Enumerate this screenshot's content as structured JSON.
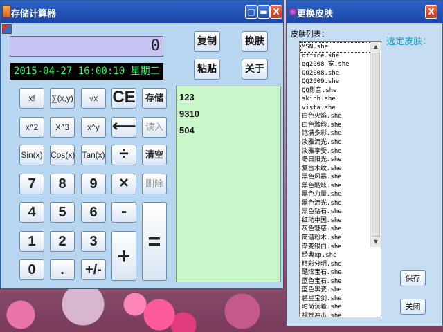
{
  "calculator": {
    "title": "存储计算器",
    "display_value": "0",
    "datetime": "2015-04-27 16:00:10 星期二",
    "window_buttons": {
      "close": "X"
    },
    "top_buttons": {
      "copy": "复制",
      "skin": "换肤",
      "paste": "粘贴",
      "about": "关于"
    },
    "keys": {
      "row1": [
        "x!",
        "∑(x,y)",
        "√x",
        "CE",
        "存储"
      ],
      "row2": [
        "x^2",
        "X^3",
        "x^y",
        "⟵",
        "读入"
      ],
      "row3": [
        "Sin(x)",
        "Cos(x)",
        "Tan(x)",
        "÷",
        "清空"
      ],
      "row4": [
        "7",
        "8",
        "9",
        "×",
        "删除"
      ],
      "row5": [
        "4",
        "5",
        "6",
        "-"
      ],
      "row6": [
        "1",
        "2",
        "3"
      ],
      "row7": [
        "0",
        ".",
        "+/-"
      ],
      "plus": "+",
      "equals": "="
    },
    "history": [
      "123",
      "9310",
      "504"
    ]
  },
  "skin_window": {
    "title": "更换皮肤",
    "close": "X",
    "list_label": "皮肤列表：",
    "select_label": "选定皮肤：",
    "items": [
      "MSN.she",
      "office.she",
      "qq2008 宽.she",
      "QQ2008.she",
      "QQ2009.she",
      "QQ影音.she",
      "skinh.she",
      "vista.she",
      "白色火焰.she",
      "白色雅韵.she",
      "饱满多彩.she",
      "淡雅流光.she",
      "淡雅享受.she",
      "冬日阳光.she",
      "复古木纹.she",
      "黑色风暴.she",
      "黑色酷炫.she",
      "黑色力量.she",
      "黑色流光.she",
      "黑色钻石.she",
      "红动中国.she",
      "灰色魅惑.she",
      "简谱粉木.she",
      "渐变银白.she",
      "经典xp.she",
      "精彩分明.she",
      "酷炫宝石.she",
      "蓝色宝石.she",
      "蓝色黑瓷.she",
      "碧星宝剑.she",
      "时尚沉着.she",
      "视觉冲击.she"
    ],
    "save_button": "保存",
    "close_button": "关闭"
  }
}
